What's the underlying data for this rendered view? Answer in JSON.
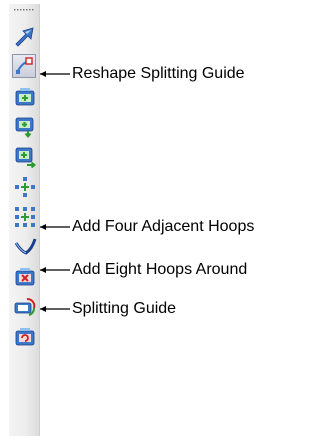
{
  "toolbar": {
    "buttons": [
      {
        "icon": "arrow-select-icon",
        "selected": false
      },
      {
        "icon": "reshape-splitting-guide-icon",
        "selected": true
      },
      {
        "icon": "frame-plus-icon",
        "selected": false
      },
      {
        "icon": "frame-plus-arrow-down-icon",
        "selected": false
      },
      {
        "icon": "frame-plus-arrow-right-icon",
        "selected": false
      },
      {
        "icon": "four-adjacent-hoops-icon",
        "selected": false
      },
      {
        "icon": "eight-hoops-around-icon",
        "selected": false
      },
      {
        "icon": "splitting-guide-icon",
        "selected": false
      },
      {
        "icon": "frame-delete-icon",
        "selected": false
      },
      {
        "icon": "frame-rotate-icon",
        "selected": false
      },
      {
        "icon": "frame-swap-icon",
        "selected": false
      }
    ]
  },
  "callouts": {
    "reshape_splitting_guide": "Reshape Splitting Guide",
    "add_four_adjacent_hoops": "Add Four Adjacent Hoops",
    "add_eight_hoops_around": "Add Eight Hoops Around",
    "splitting_guide": "Splitting Guide"
  },
  "colors": {
    "icon_blue": "#3d78c8",
    "icon_light_blue": "#8fc0ee",
    "icon_green": "#2f9a2f",
    "icon_red": "#d02020",
    "accent_dark": "#1a3f8a"
  }
}
